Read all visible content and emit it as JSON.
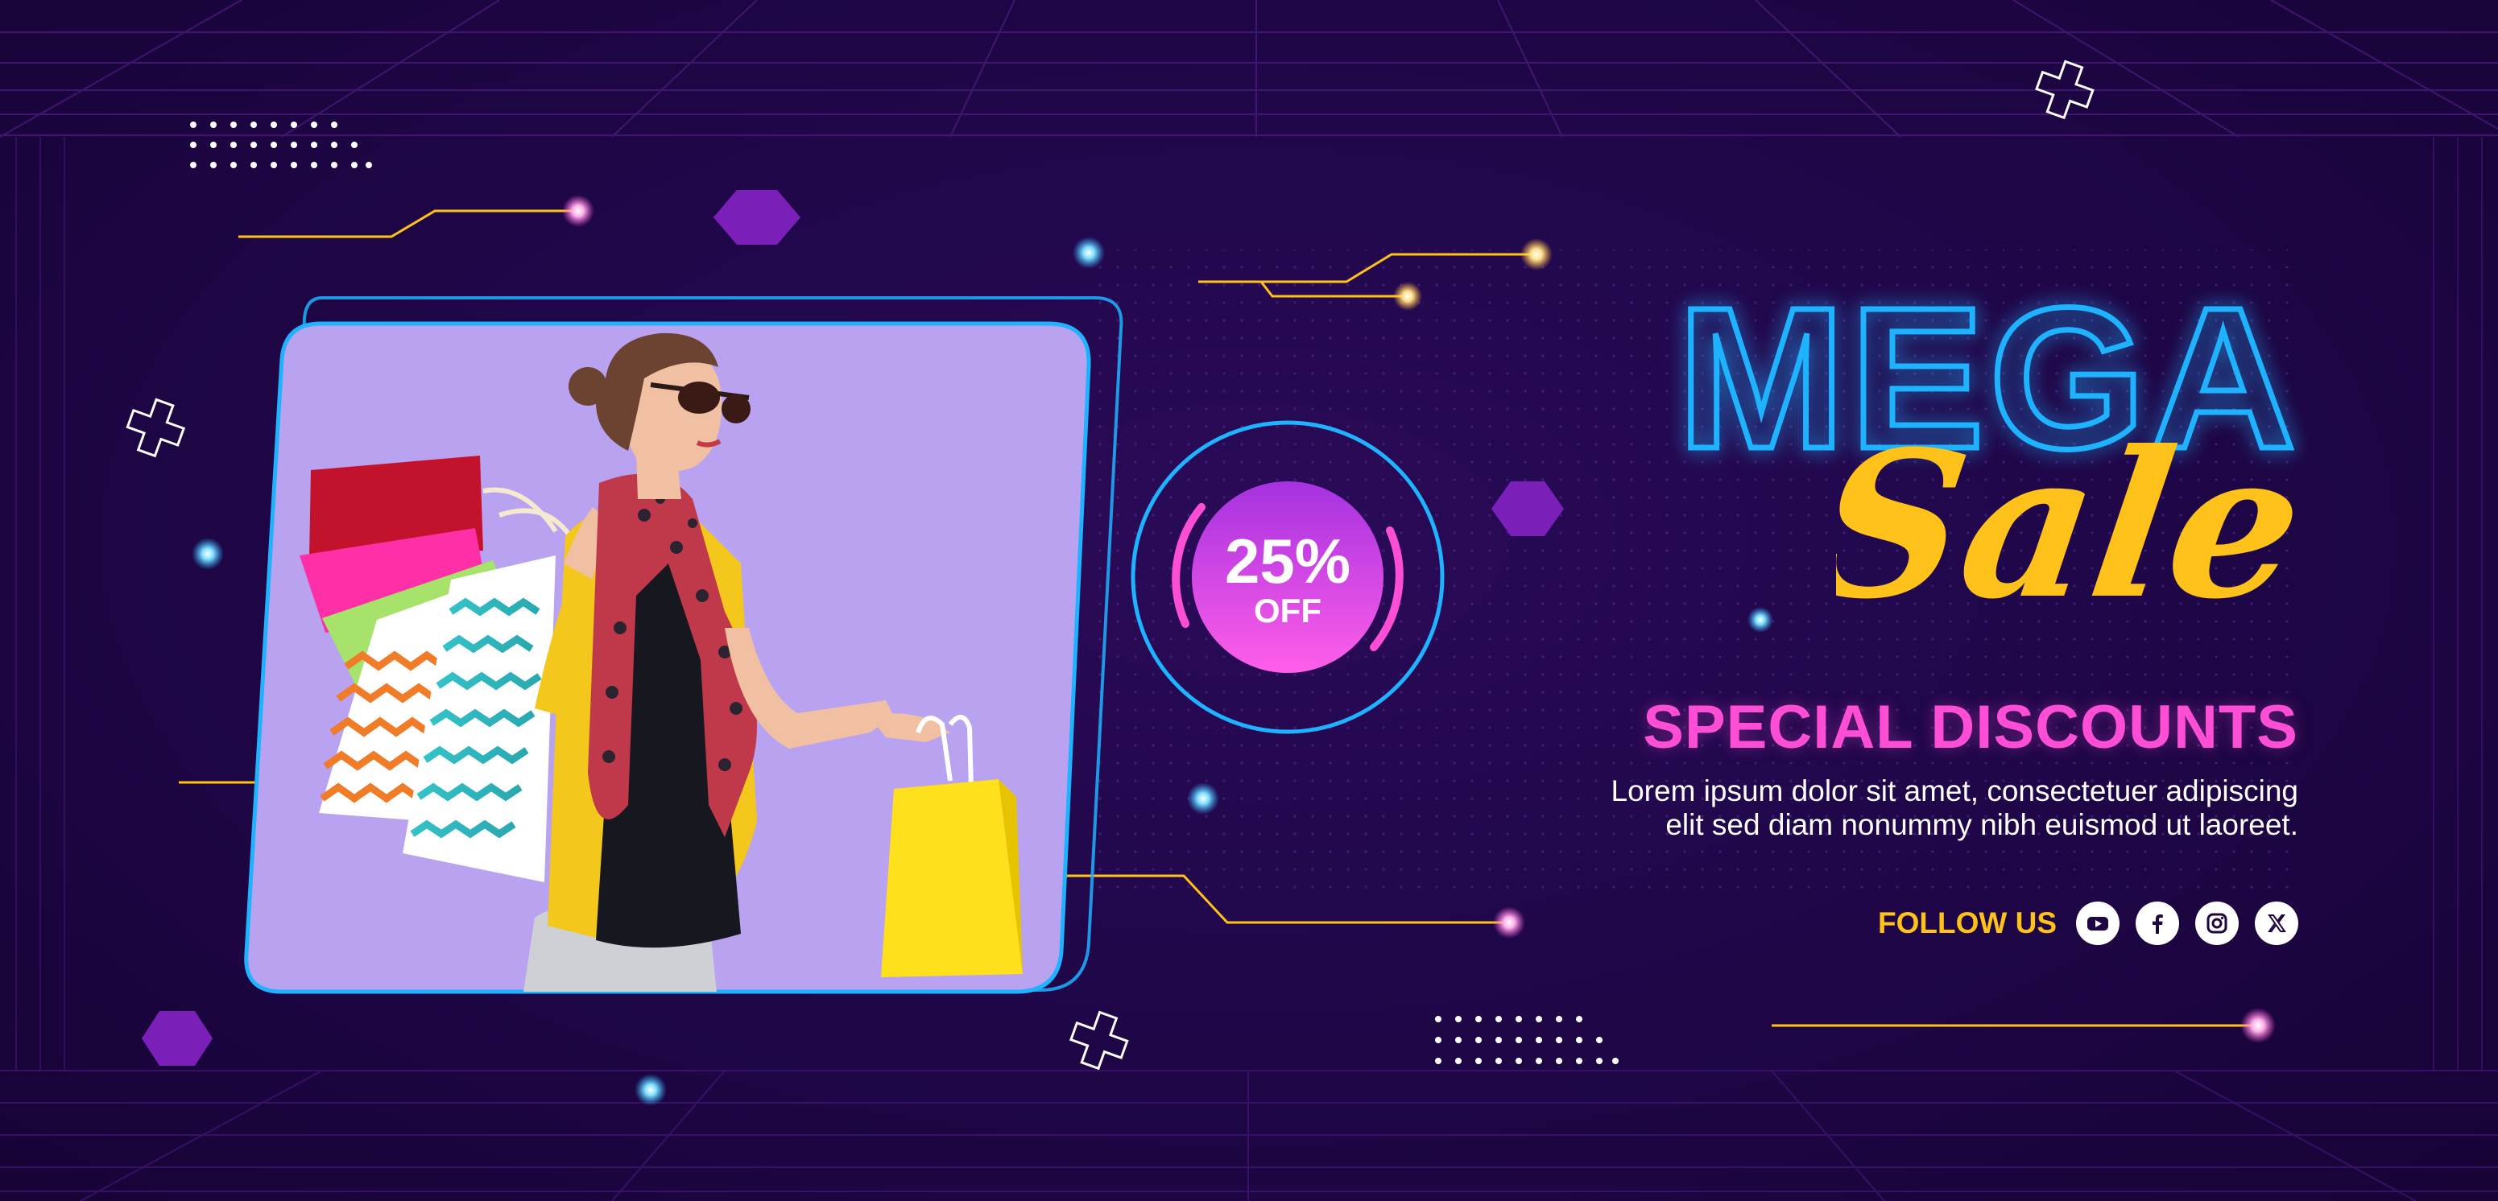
{
  "headline": {
    "mega": "MEGA",
    "sale": "Sale"
  },
  "badge": {
    "percent": "25%",
    "off": "OFF"
  },
  "subheading": "SPECIAL DISCOUNTS",
  "body_lines": [
    "Lorem ipsum dolor sit amet, consectetuer adipiscing",
    "elit sed diam nonummy nibh euismod ut laoreet."
  ],
  "follow": {
    "label": "FOLLOW US",
    "icons": [
      "youtube-icon",
      "facebook-icon",
      "instagram-icon",
      "x-icon"
    ]
  },
  "colors": {
    "background": "#1e0640",
    "neon_blue": "#1fb2ff",
    "neon_yellow": "#ffc21a",
    "pink": "#ff4ed6",
    "photo_bg": "#b9a2f0",
    "hexagon": "#7a1fb8"
  }
}
